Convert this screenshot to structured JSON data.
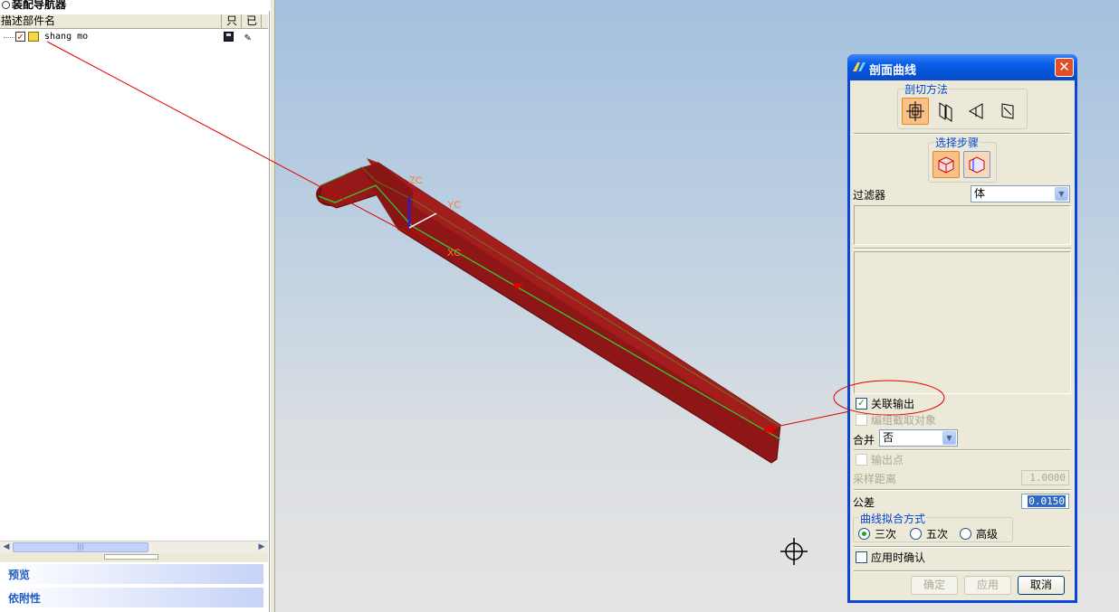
{
  "navigator": {
    "title": "装配导航器",
    "columns": {
      "description": "描述部件名",
      "readonly": "只",
      "modified": "已"
    },
    "parts": [
      {
        "name": "shang mo"
      }
    ],
    "sections": {
      "preview": "预览",
      "dependencies": "依附性"
    }
  },
  "viewport": {
    "axes": {
      "zc": "ZC",
      "yc": "YC",
      "xc": "XC"
    },
    "colors": {
      "model": "#8b1414",
      "centerline": "#33cc33",
      "annotation": "#e00000"
    }
  },
  "dialog": {
    "title": "剖面曲线",
    "close_glyph": "✕",
    "section_method": {
      "label": "剖切方法"
    },
    "selection_steps": {
      "label": "选择步骤"
    },
    "filter": {
      "label": "过滤器",
      "value": "体"
    },
    "associative_output": {
      "label": "关联输出",
      "checked": true
    },
    "group_sections": {
      "label": "编组截取对象",
      "checked": false
    },
    "join": {
      "label": "合并",
      "value": "否"
    },
    "output_points": {
      "label": "输出点",
      "checked": false
    },
    "sample_distance": {
      "label": "采样距离",
      "value": "1.0000"
    },
    "tolerance": {
      "label": "公差",
      "value": "0.0150"
    },
    "curve_fit": {
      "label": "曲线拟合方式",
      "options": [
        {
          "label": "三次",
          "selected": true
        },
        {
          "label": "五次",
          "selected": false
        },
        {
          "label": "高级",
          "selected": false
        }
      ]
    },
    "confirm_on_apply": {
      "label": "应用时确认",
      "checked": false
    },
    "buttons": {
      "ok": "确定",
      "apply": "应用",
      "cancel": "取消"
    }
  }
}
